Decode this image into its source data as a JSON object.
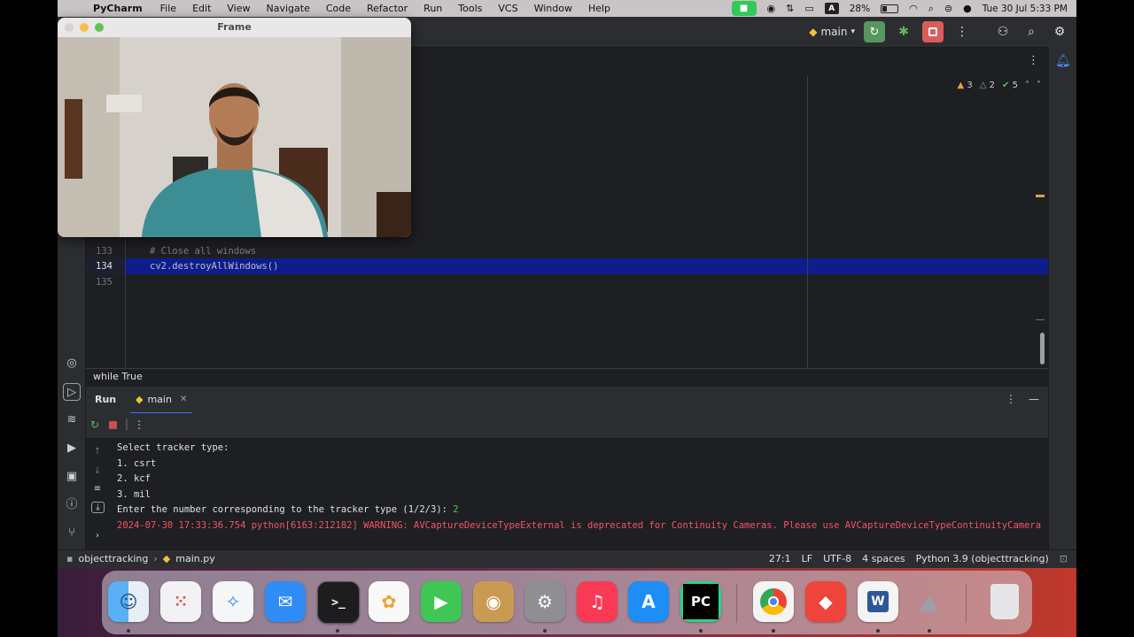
{
  "menubar": {
    "app": "PyCharm",
    "items": [
      "File",
      "Edit",
      "View",
      "Navigate",
      "Code",
      "Refactor",
      "Run",
      "Tools",
      "VCS",
      "Window",
      "Help"
    ],
    "battery": "28%",
    "input_source": "A",
    "datetime": "Tue 30 Jul  5:33 PM"
  },
  "toolbar": {
    "branch": "main"
  },
  "frame_window": {
    "title": "Frame"
  },
  "editor": {
    "inspections": {
      "warnings": "3",
      "weak_warnings": "2",
      "ok": "5"
    },
    "lines": [
      {
        "num": "133",
        "text": "# Close all windows",
        "comment": true
      },
      {
        "num": "134",
        "text": "cv2.destroyAllWindows()",
        "comment": false
      },
      {
        "num": "135",
        "text": "",
        "comment": false
      }
    ],
    "breadcrumb": "while True"
  },
  "run_panel": {
    "title": "Run",
    "tab": "main",
    "output": [
      "Select tracker type:",
      "1. csrt",
      "2. kcf",
      "3. mil",
      "Enter the number corresponding to the tracker type (1/2/3): "
    ],
    "user_input": "2",
    "error_line": "2024-07-30 17:33:36.754 python[6163:212182] WARNING: AVCaptureDeviceTypeExternal is deprecated for Continuity Cameras. Please use AVCaptureDeviceTypeContinuityCamera"
  },
  "statusbar": {
    "project": "objecttracking",
    "file": "main.py",
    "position": "27:1",
    "line_sep": "LF",
    "encoding": "UTF-8",
    "indent": "4 spaces",
    "interpreter": "Python 3.9 (objecttracking)"
  },
  "dock": {
    "apps": [
      "finder-icon",
      "launchpad-icon",
      "safari-icon",
      "mail-icon",
      "terminal-icon",
      "photos-icon",
      "facetime-icon",
      "contacts-icon",
      "system-settings-icon",
      "music-icon",
      "app-store-icon",
      "pycharm-icon",
      "chrome-icon",
      "anydesk-icon",
      "word-icon",
      "python-launcher-icon",
      "trash-icon"
    ]
  }
}
